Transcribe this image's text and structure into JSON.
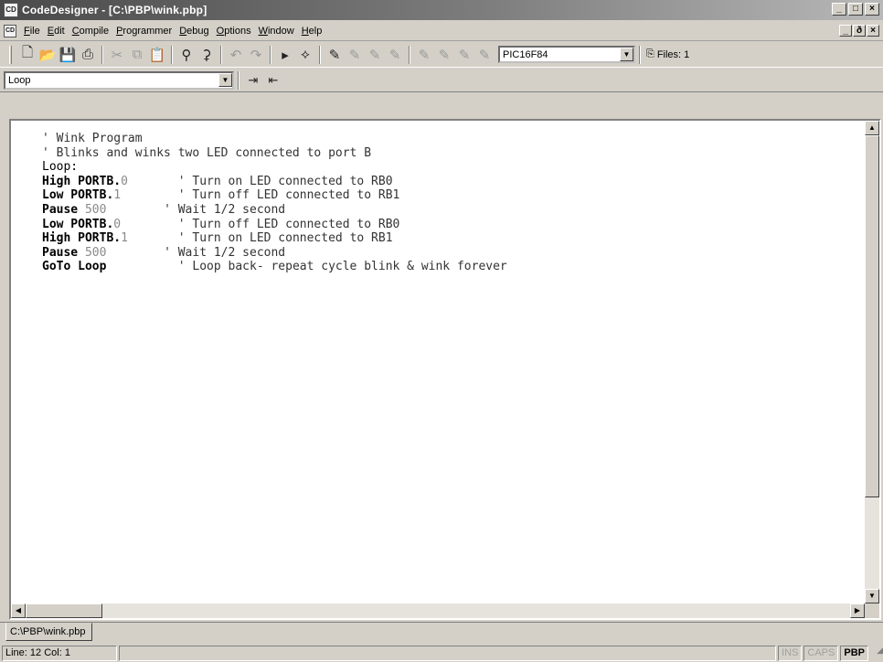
{
  "window": {
    "title": "CodeDesigner - [C:\\PBP\\wink.pbp]",
    "min": "_",
    "max": "□",
    "close": "×"
  },
  "menu": [
    "File",
    "Edit",
    "Compile",
    "Programmer",
    "Debug",
    "Options",
    "Window",
    "Help"
  ],
  "mdi_controls": {
    "min": "_",
    "restore": "ð",
    "close": "×"
  },
  "toolbar": {
    "device": "PIC16F84",
    "files_label": "Files: 1",
    "icons": [
      "new-file-icon",
      "open-folder-icon",
      "save-icon",
      "print-icon",
      "cut-icon",
      "copy-icon",
      "paste-icon",
      "find-icon",
      "replace-icon",
      "undo-icon",
      "redo-icon",
      "compile-icon",
      "program-icon",
      "bookmark-icon",
      "bookmark-next-icon",
      "bookmark-prev-icon",
      "bookmark-clear-icon",
      "files-icon"
    ]
  },
  "label_bar": {
    "selected": "Loop",
    "icons": [
      "indent-icon",
      "outdent-icon"
    ]
  },
  "code": [
    [
      {
        "t": "' Wink Program",
        "c": "comment"
      }
    ],
    [
      {
        "t": "' Blinks and winks two LED connected to port B",
        "c": "comment"
      }
    ],
    [
      {
        "t": "Loop:",
        "c": "plain"
      }
    ],
    [
      {
        "t": "High PORTB",
        "c": "kw"
      },
      {
        "t": ".",
        "c": "kw"
      },
      {
        "t": "0",
        "c": "num"
      },
      {
        "t": "       ' Turn on LED connected to RB0",
        "c": "comment"
      }
    ],
    [
      {
        "t": "Low PORTB",
        "c": "kw"
      },
      {
        "t": ".",
        "c": "kw"
      },
      {
        "t": "1",
        "c": "num"
      },
      {
        "t": "        ' Turn off LED connected to RB1",
        "c": "comment"
      }
    ],
    [
      {
        "t": "Pause",
        "c": "kw"
      },
      {
        "t": " 500",
        "c": "num"
      },
      {
        "t": "        ' Wait 1/2 second",
        "c": "comment"
      }
    ],
    [
      {
        "t": "Low PORTB",
        "c": "kw"
      },
      {
        "t": ".",
        "c": "kw"
      },
      {
        "t": "0",
        "c": "num"
      },
      {
        "t": "        ' Turn off LED connected to RB0",
        "c": "comment"
      }
    ],
    [
      {
        "t": "High PORTB",
        "c": "kw"
      },
      {
        "t": ".",
        "c": "kw"
      },
      {
        "t": "1",
        "c": "num"
      },
      {
        "t": "       ' Turn on LED connected to RB1",
        "c": "comment"
      }
    ],
    [
      {
        "t": "Pause",
        "c": "kw"
      },
      {
        "t": " 500",
        "c": "num"
      },
      {
        "t": "        ' Wait 1/2 second",
        "c": "comment"
      }
    ],
    [
      {
        "t": "GoTo Loop",
        "c": "kw"
      },
      {
        "t": "          ' Loop back- repeat cycle blink & wink forever",
        "c": "comment"
      }
    ]
  ],
  "doc_tab": "C:\\PBP\\wink.pbp",
  "status": {
    "position": "Line: 12 Col: 1",
    "ins": "INS",
    "caps": "CAPS",
    "mode": "PBP"
  }
}
